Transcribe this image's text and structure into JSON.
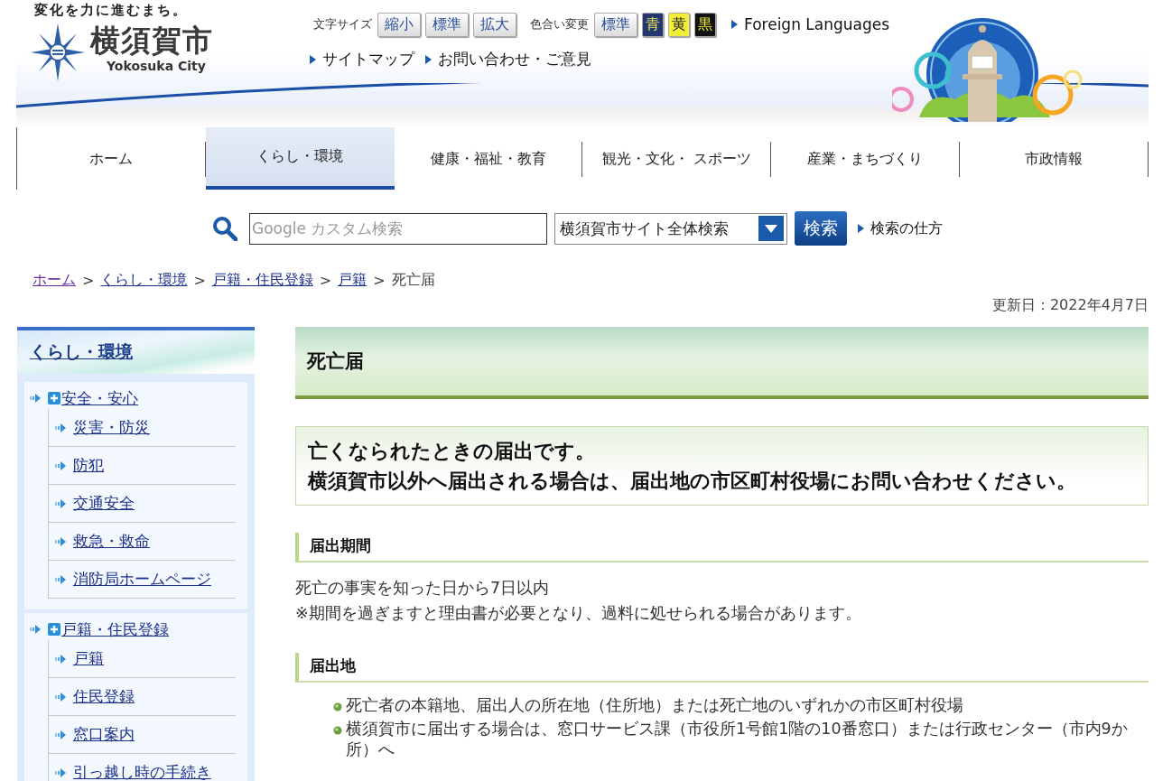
{
  "header": {
    "tagline": "変化を力に進むまち。",
    "city_name": "横須賀市",
    "city_name_en": "Yokosuka City",
    "font_size": {
      "label": "文字サイズ",
      "buttons": [
        {
          "label": "縮小"
        },
        {
          "label": "標準"
        },
        {
          "label": "拡大"
        }
      ]
    },
    "color_change": {
      "label": "色合い変更",
      "buttons": [
        {
          "label": "標準",
          "kind": "standard"
        },
        {
          "label": "青",
          "kind": "blue"
        },
        {
          "label": "黄",
          "kind": "yellow"
        },
        {
          "label": "黒",
          "kind": "black"
        }
      ]
    },
    "language_link": "Foreign Languages",
    "links": [
      "サイトマップ",
      "お問い合わせ・ご意見"
    ]
  },
  "nav": [
    {
      "label": "ホーム",
      "selected": false
    },
    {
      "label": "くらし・環境",
      "selected": true
    },
    {
      "label": "健康・福祉・教育",
      "selected": false
    },
    {
      "label": "観光・文化・ スポーツ",
      "selected": false
    },
    {
      "label": "産業・まちづくり",
      "selected": false
    },
    {
      "label": "市政情報",
      "selected": false
    }
  ],
  "search": {
    "placeholder": "Google カスタム検索",
    "scope": "横須賀市サイト全体検索",
    "button": "検索",
    "help_link": "検索の仕方"
  },
  "breadcrumb": {
    "separator": ">",
    "items": [
      {
        "label": "ホーム",
        "link": true
      },
      {
        "label": "くらし・環境",
        "link": true
      },
      {
        "label": "戸籍・住民登録",
        "link": true
      },
      {
        "label": "戸籍",
        "link": true
      },
      {
        "label": "死亡届",
        "link": false
      }
    ]
  },
  "updated": "更新日：2022年4月7日",
  "sidebar": {
    "title": "くらし・環境",
    "groups": [
      {
        "label": "安全・安心",
        "children": [
          "災害・防災",
          "防犯",
          "交通安全",
          "救急・救命",
          "消防局ホームページ"
        ]
      },
      {
        "label": "戸籍・住民登録",
        "children": [
          "戸籍",
          "住民登録",
          "窓口案内",
          "引っ越し時の手続き"
        ]
      }
    ]
  },
  "main": {
    "title": "死亡届",
    "notice": [
      "亡くなられたときの届出です。",
      "横須賀市以外へ届出される場合は、届出地の市区町村役場にお問い合わせください。"
    ],
    "sections": [
      {
        "heading": "届出期間",
        "kind": "paragraphs",
        "items": [
          "死亡の事実を知った日から7日以内",
          "※期間を過ぎますと理由書が必要となり、過料に処せられる場合があります。"
        ]
      },
      {
        "heading": "届出地",
        "kind": "bullets",
        "items": [
          "死亡者の本籍地、届出人の所在地（住所地）または死亡地のいずれかの市区町村役場",
          "横須賀市に届出する場合は、窓口サービス課（市役所1号館1階の10番窓口）または行政センター（市内9か所）へ"
        ]
      }
    ]
  }
}
